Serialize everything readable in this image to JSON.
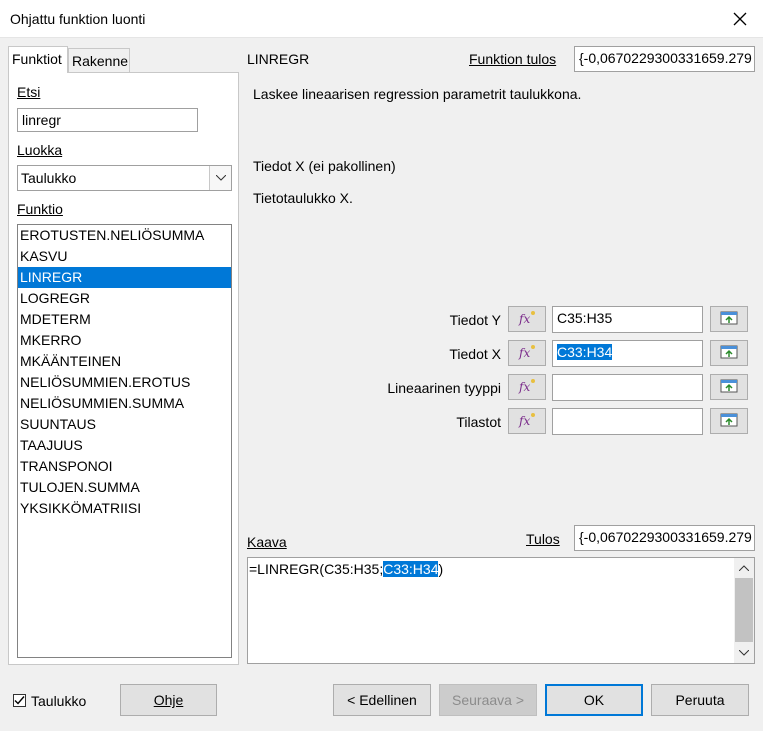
{
  "window": {
    "title": "Ohjattu funktion luonti"
  },
  "tabs": [
    {
      "label": "Funktiot"
    },
    {
      "label": "Rakenne"
    }
  ],
  "search": {
    "label": "Etsi",
    "value": "linregr"
  },
  "category": {
    "label": "Luokka",
    "value": "Taulukko"
  },
  "function_list": {
    "label": "Funktio",
    "items": [
      "EROTUSTEN.NELIÖSUMMA",
      "KASVU",
      "LINREGR",
      "LOGREGR",
      "MDETERM",
      "MKERRO",
      "MKÄÄNTEINEN",
      "NELIÖSUMMIEN.EROTUS",
      "NELIÖSUMMIEN.SUMMA",
      "SUUNTAUS",
      "TAAJUUS",
      "TRANSPONOI",
      "TULOJEN.SUMMA",
      "YKSIKKÖMATRIISI"
    ],
    "selected_index": 2
  },
  "function_info": {
    "name": "LINREGR",
    "result_label": "Funktion tulos",
    "result_value": "{-0,0670229300331659.279",
    "description": "Laskee lineaarisen regression parametrit taulukkona.",
    "arg_title": "Tiedot X (ei pakollinen)",
    "arg_description": "Tietotaulukko X."
  },
  "arguments": [
    {
      "label": "Tiedot Y",
      "value": "C35:H35",
      "selected": false
    },
    {
      "label": "Tiedot X",
      "value": "C33:H34",
      "selected": true
    },
    {
      "label": "Lineaarinen tyyppi",
      "value": "",
      "selected": false
    },
    {
      "label": "Tilastot",
      "value": "",
      "selected": false
    }
  ],
  "formula": {
    "label": "Kaava",
    "result_label": "Tulos",
    "result_value": "{-0,0670229300331659.279",
    "text_before": "=LINREGR(C35:H35;",
    "text_selected": "C33:H34",
    "text_after": ")"
  },
  "footer": {
    "array_checkbox_label": "Taulukko",
    "array_checked": true,
    "help": "Ohje",
    "back": "< Edellinen",
    "next": "Seuraava >",
    "ok": "OK",
    "cancel": "Peruuta"
  },
  "colors": {
    "accent": "#0078d7",
    "panel_bg": "#f0f0f0"
  }
}
